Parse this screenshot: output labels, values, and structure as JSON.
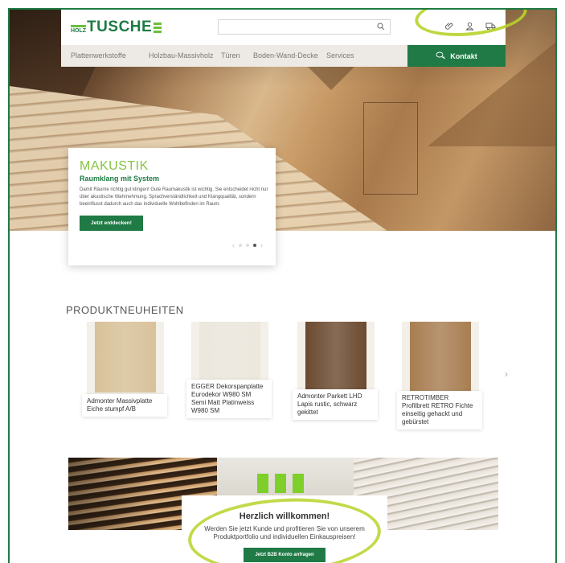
{
  "header": {
    "logo_small": "HOLZ",
    "logo_main": "TUSCHE",
    "search_placeholder": "",
    "icons": [
      "paperclip-icon",
      "user-icon",
      "truck-icon"
    ]
  },
  "nav": {
    "items": [
      "Plattenwerkstoffe",
      "Holzbau-Massivholz",
      "Türen",
      "Boden-Wand-Decke",
      "Services"
    ],
    "kontakt": "Kontakt"
  },
  "hero_card": {
    "title": "MAKUSTIK",
    "subtitle": "Raumklang mit System",
    "text": "Damit Räume richtig gut klingen! Gute Raumakustik ist wichtig. Sie entscheidet nicht nur über akustische Wahrnehmung, Sprachverständlichkeit und Klangqualität, sondern beeinflusst dadurch auch das individuelle Wohlbefinden im Raum.",
    "button": "Jetzt entdecken!",
    "prev": "‹",
    "next": "›"
  },
  "products": {
    "title": "PRODUKTNEUHEITEN",
    "items": [
      {
        "name": "Admonter Massivplatte Eiche stumpf A/B",
        "swatch": "#d8c29a"
      },
      {
        "name": "EGGER Dekorspanplatte Eurodekor W980 SM Semi Matt Platinweiss W980 SM",
        "swatch": "#ece8de"
      },
      {
        "name": "Admonter Parkett LHD Lapis rustic, schwarz gekittet",
        "swatch": "#6b4a30"
      },
      {
        "name": "RETROTIMBER Profilbrett RETRO Fichte einseitig gehackt und gebürstet",
        "swatch": "#a87e52"
      }
    ],
    "next": "›"
  },
  "welcome": {
    "heading": "Herzlich willkommen!",
    "text": "Werden Sie jetzt Kunde und profitieren Sie von unserem Produktportfolio und individuellen Einkauspreisen!",
    "button": "Jetzt B2B Konto anfragen"
  },
  "colors": {
    "brand_green": "#1f7a45",
    "accent_green": "#86c541",
    "highlight": "#b7d32a"
  }
}
